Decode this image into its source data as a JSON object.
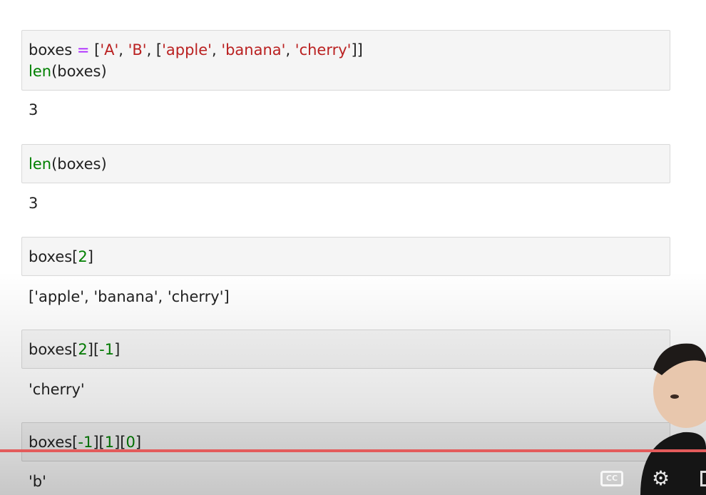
{
  "cells": [
    {
      "input_line1": {
        "var": "boxes ",
        "op": "=",
        "open": " [",
        "a": "'A'",
        "c1": ", ",
        "b": "'B'",
        "c2": ", [",
        "apple": "'apple'",
        "c3": ", ",
        "banana": "'banana'",
        "c4": ", ",
        "cherry": "'cherry'",
        "close": "]]"
      },
      "input_line2": {
        "fn": "len",
        "args": "(boxes)"
      },
      "output": "3"
    },
    {
      "input": {
        "fn": "len",
        "args": "(boxes)"
      },
      "output": "3"
    },
    {
      "input": {
        "var": "boxes[",
        "idx": "2",
        "close": "]"
      },
      "output": "['apple', 'banana', 'cherry']"
    },
    {
      "input": {
        "var": "boxes[",
        "idx1": "2",
        "mid": "][",
        "idx2": "-1",
        "close": "]"
      },
      "output": "'cherry'"
    },
    {
      "input": {
        "var": "boxes[",
        "idx1": "-1",
        "m1": "][",
        "idx2": "1",
        "m2": "][",
        "idx3": "0",
        "close": "]"
      },
      "output": "'b'"
    }
  ],
  "player": {
    "cc_label": "CC",
    "settings_icon": "gear-icon",
    "progress_color": "#e35b5b"
  }
}
